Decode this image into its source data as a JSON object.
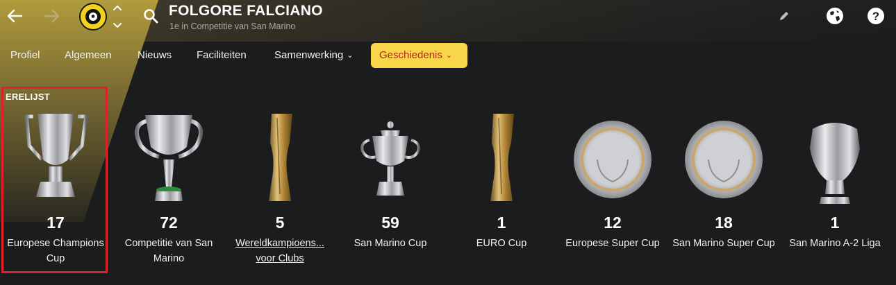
{
  "header": {
    "club_name": "FOLGORE FALCIANO",
    "subtitle": "1e in Competitie van San Marino"
  },
  "icons": {
    "back": "arrow-left-icon",
    "forward": "arrow-right-icon",
    "switch": "chevron-up-down-icon",
    "search": "search-icon",
    "edit": "pencil-icon",
    "world": "globe-icon",
    "help": "question-icon"
  },
  "tabs": [
    {
      "label": "Profiel",
      "dropdown": false
    },
    {
      "label": "Algemeen",
      "dropdown": false
    },
    {
      "label": "Nieuws",
      "dropdown": false
    },
    {
      "label": "Faciliteiten",
      "dropdown": false
    },
    {
      "label": "Samenwerking",
      "dropdown": true
    },
    {
      "label": "Geschiedenis",
      "dropdown": true,
      "active": true
    }
  ],
  "section": {
    "label": "ERELIJST"
  },
  "trophies": [
    {
      "count": "17",
      "name": "Europese Champions Cup",
      "art": "big-cup"
    },
    {
      "count": "72",
      "name": "Competitie van San Marino",
      "art": "league-cup"
    },
    {
      "count": "5",
      "name": "Wereldkampioens... voor Clubs",
      "art": "gold-tall"
    },
    {
      "count": "59",
      "name": "San Marino Cup",
      "art": "small-cup"
    },
    {
      "count": "1",
      "name": "EURO Cup",
      "art": "gold-tall"
    },
    {
      "count": "12",
      "name": "Europese Super Cup",
      "art": "plate"
    },
    {
      "count": "18",
      "name": "San Marino Super Cup",
      "art": "plate"
    },
    {
      "count": "1",
      "name": "San Marino A-2 Liga",
      "art": "shield"
    }
  ],
  "colors": {
    "accent_tab": "#f7d64a",
    "accent_tab_text": "#b6231c",
    "highlight_border": "#e0212a",
    "club_yellow": "#f2d21b"
  }
}
